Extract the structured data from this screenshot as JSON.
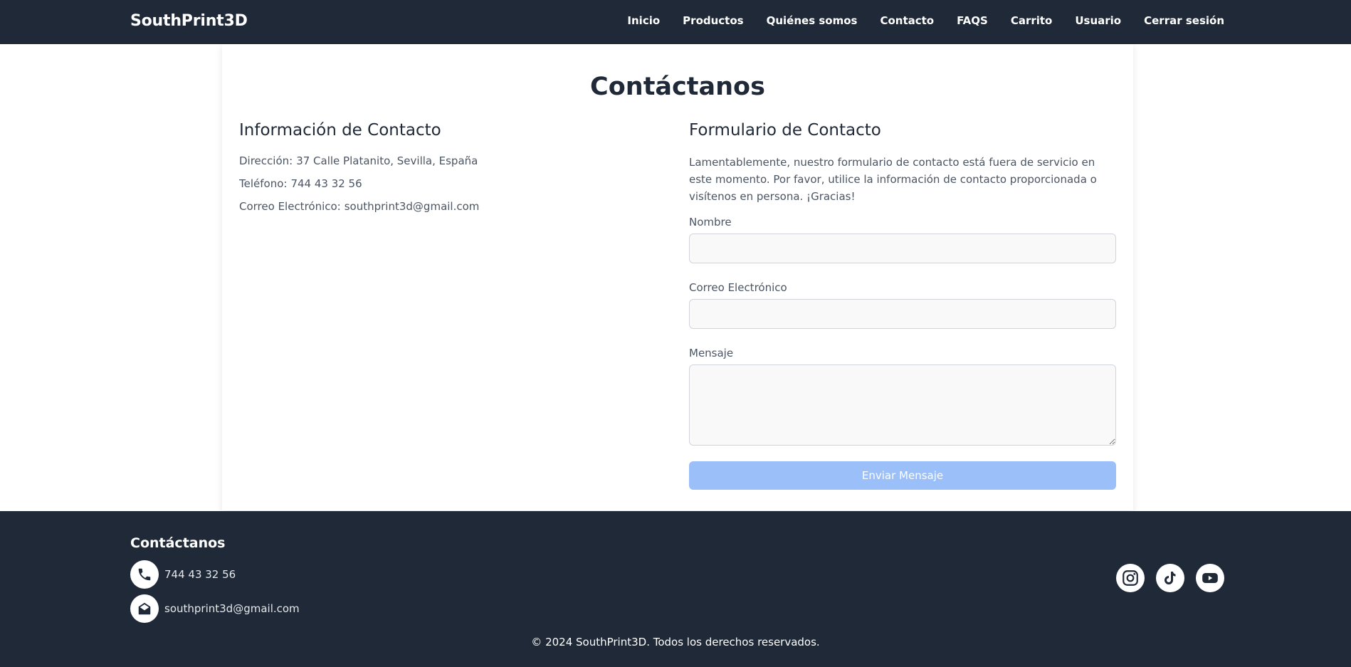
{
  "header": {
    "brand": "SouthPrint3D",
    "nav": [
      "Inicio",
      "Productos",
      "Quiénes somos",
      "Contacto",
      "FAQS",
      "Carrito",
      "Usuario",
      "Cerrar sesión"
    ]
  },
  "main": {
    "title": "Contáctanos",
    "info": {
      "heading": "Información de Contacto",
      "address_label": "Dirección:",
      "address": "37 Calle Platanito, Sevilla, España",
      "phone_label": "Teléfono:",
      "phone": "744 43 32 56",
      "email_label": "Correo Electrónico:",
      "email": "southprint3d@gmail.com"
    },
    "form": {
      "heading": "Formulario de Contacto",
      "notice": "Lamentablemente, nuestro formulario de contacto está fuera de servicio en este momento. Por favor, utilice la información de contacto proporcionada o visítenos en persona. ¡Gracias!",
      "name_label": "Nombre",
      "name_value": "",
      "email_label": "Correo Electrónico",
      "email_value": "",
      "message_label": "Mensaje",
      "message_value": "",
      "submit_label": "Enviar Mensaje"
    }
  },
  "footer": {
    "title": "Contáctanos",
    "phone": "744 43 32 56",
    "email": "southprint3d@gmail.com",
    "socials": [
      "instagram-icon",
      "tiktok-icon",
      "youtube-icon"
    ],
    "copyright": "© 2024 SouthPrint3D. Todos los derechos reservados."
  },
  "colors": {
    "navy": "#1f2937",
    "button_disabled": "#9bbff9",
    "text_muted": "#4b5563"
  }
}
